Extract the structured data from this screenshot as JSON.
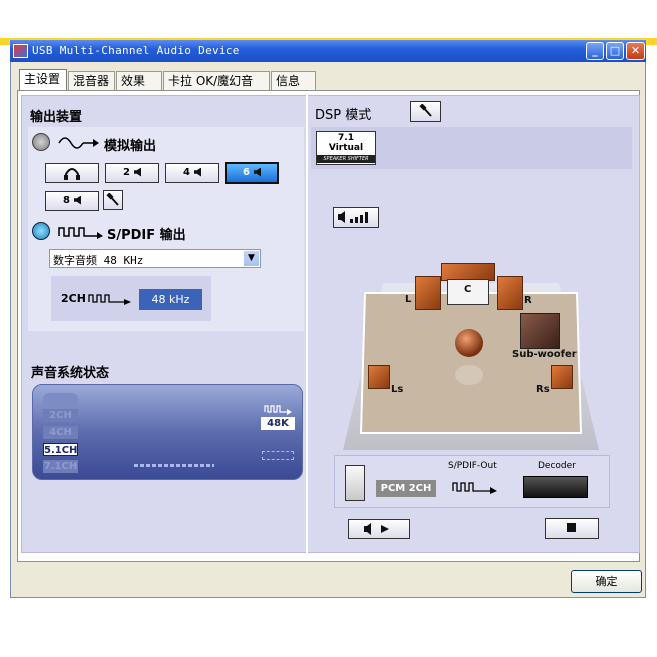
{
  "window": {
    "title": "USB Multi-Channel Audio Device",
    "tabs": [
      "主设置",
      "混音器",
      "效果",
      "卡拉 OK/魔幻音响",
      "信息"
    ],
    "active_tab": "主设置",
    "ok_label": "确定"
  },
  "output": {
    "heading": "输出装置",
    "analog_label": "模拟输出",
    "channel_buttons": [
      "2",
      "4",
      "6",
      "8"
    ],
    "selected_channels": "6",
    "spdif_label": "S/PDIF 输出",
    "spdif_select_value": "数字音频 48 KHz",
    "spdif_mode": "2CH",
    "spdif_rate": "48 kHz"
  },
  "status": {
    "heading": "声音系统状态",
    "channels": [
      "2CH",
      "4CH",
      "5.1CH",
      "7.1CH"
    ],
    "active_channel": "5.1CH",
    "rate": "48K"
  },
  "dsp": {
    "heading": "DSP 模式",
    "virtual_top": "7.1",
    "virtual_mid": "Virtual",
    "virtual_bottom": "SPEAKER SHIFTER",
    "speakers": {
      "l": "L",
      "c": "C",
      "r": "R",
      "sub": "Sub-woofer",
      "ls": "Ls",
      "rs": "Rs"
    },
    "signal": {
      "source": "PCM 2CH",
      "spdif_out": "S/PDIF-Out",
      "decoder": "Decoder"
    }
  },
  "colors": {
    "accent": "#1a6fd8",
    "panel": "#d8d9ef",
    "titlebar": "#245edb"
  }
}
